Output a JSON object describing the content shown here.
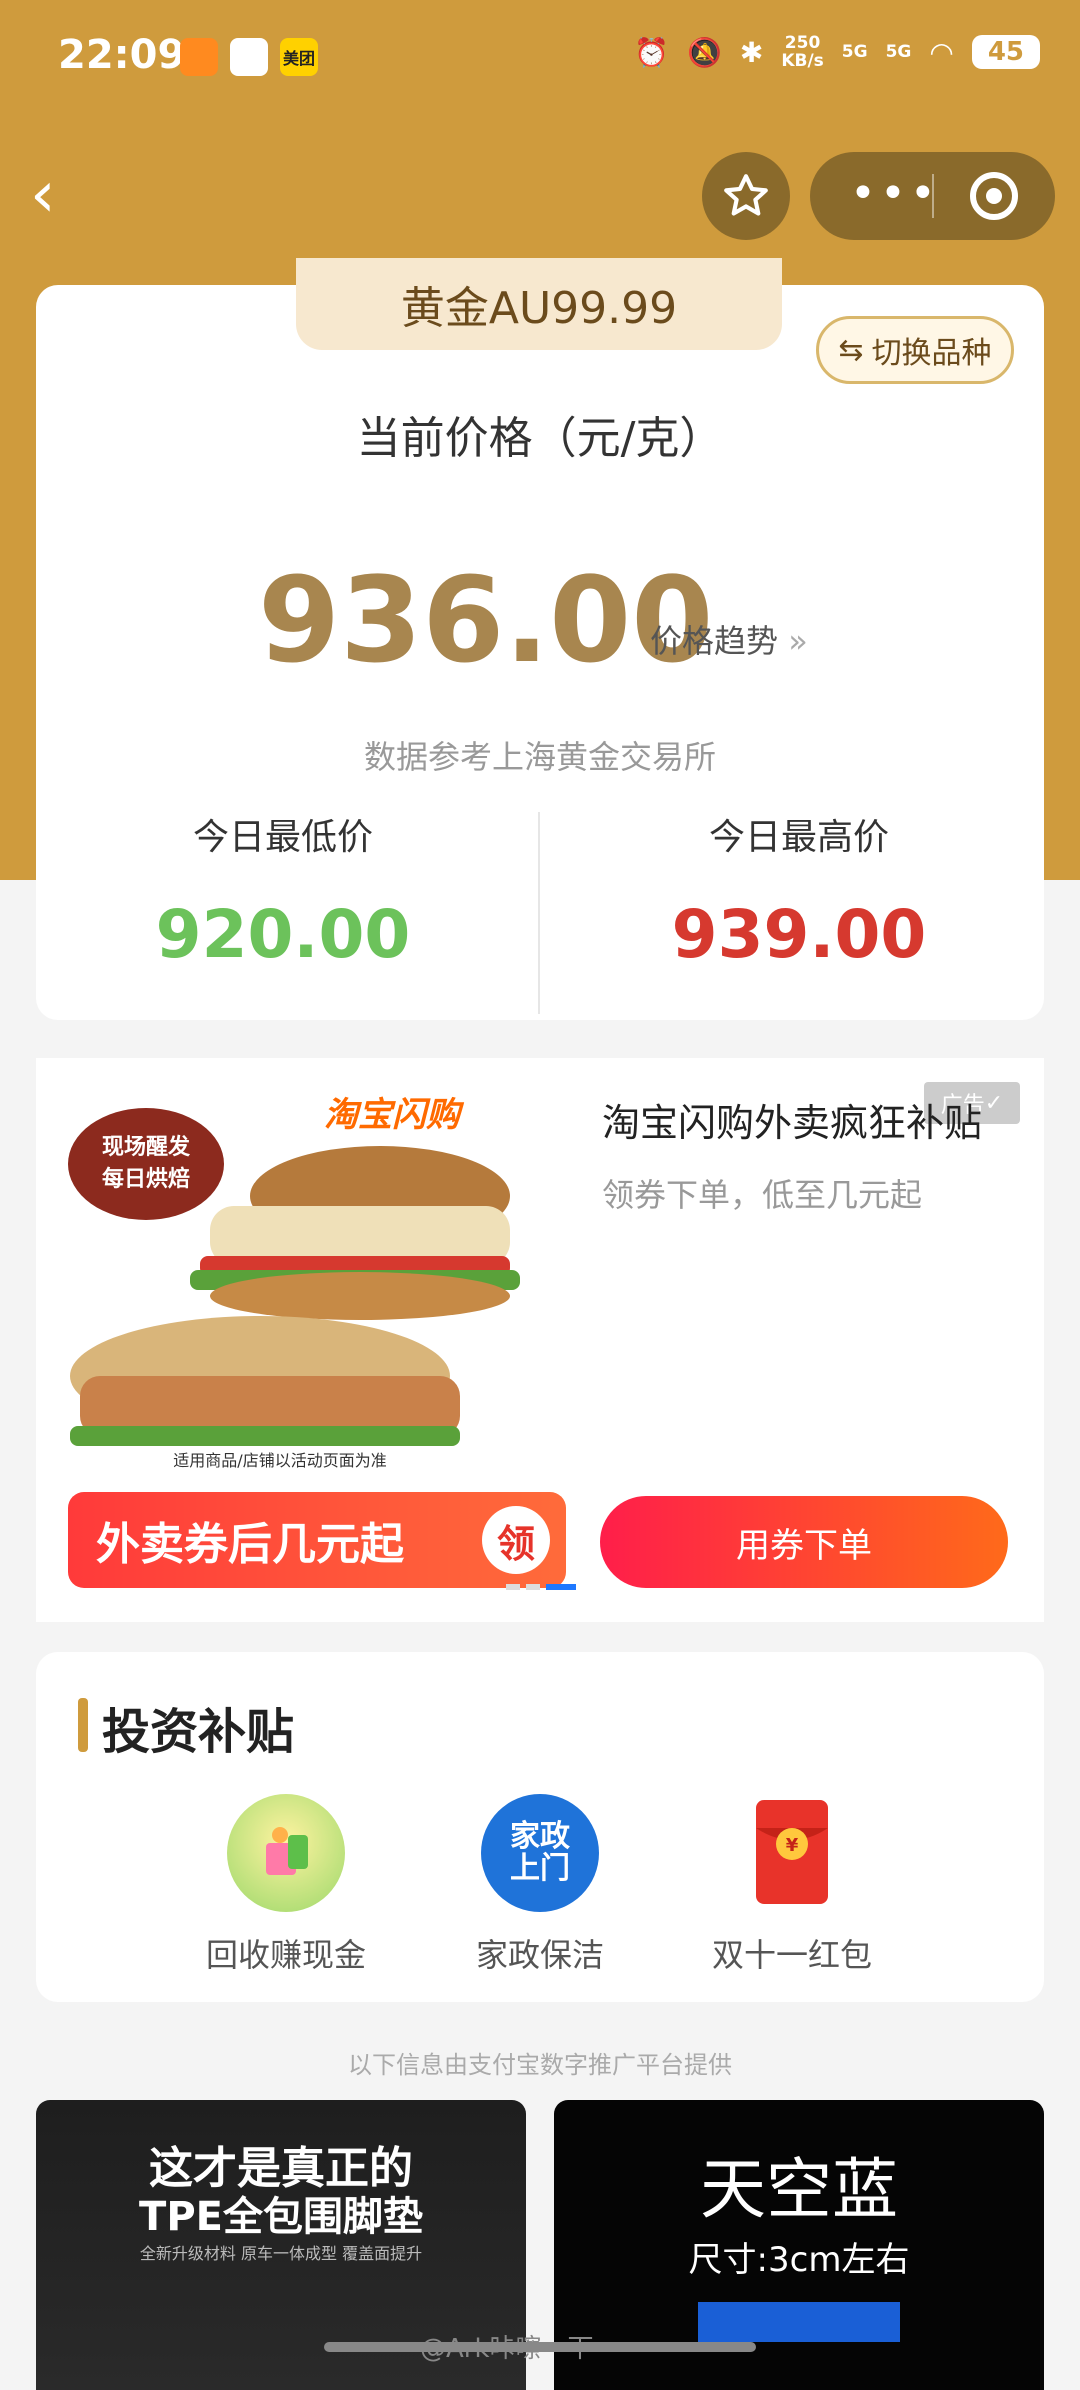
{
  "status_bar": {
    "time": "22:09",
    "net_speed": "250",
    "net_unit": "KB/s",
    "signal1": "5G",
    "signal2": "5G",
    "battery": "45",
    "app3_label": "美团"
  },
  "price": {
    "tab_title": "黄金AU99.99",
    "switch_label": "切换品种",
    "current_label": "当前价格（元/克）",
    "current_value": "936.00",
    "trend_link": "价格趋势",
    "source": "数据参考上海黄金交易所",
    "low_label": "今日最低价",
    "low_value": "920.00",
    "high_label": "今日最高价",
    "high_value": "939.00"
  },
  "ad": {
    "title": "淘宝闪购外卖疯狂补贴",
    "subtitle": "领券下单，低至几元起",
    "badge": "广告",
    "brand": "淘宝闪购",
    "stamp_top": "现场醒发",
    "stamp_bottom": "每日烘焙",
    "image_note": "适用商品/店铺以活动页面为准",
    "banner_text": "外卖券后几元起",
    "banner_circle": "领",
    "cta": "用券下单"
  },
  "invest": {
    "title": "投资补贴",
    "items": [
      {
        "label": "回收赚现金"
      },
      {
        "label": "家政保洁",
        "icon_text": "家政上门"
      },
      {
        "label": "双十一红包"
      }
    ]
  },
  "provider_note": "以下信息由支付宝数字推广平台提供",
  "bottom_ads": {
    "left": {
      "line1": "这才是真正的",
      "line2": "TPE全包围脚垫",
      "line3": "全新升级材料  原车一体成型  覆盖面提升"
    },
    "right": {
      "line1": "天空蓝",
      "line2": "尺寸:3cm左右"
    }
  },
  "watermark": "@Ark咔嚓一下",
  "colors": {
    "gold": "#cf9b3d",
    "price_gold": "#a8864f",
    "low_green": "#6cc25b",
    "high_red": "#d6392f",
    "cta_start": "#ff1e4a",
    "cta_end": "#ff6a1a"
  }
}
